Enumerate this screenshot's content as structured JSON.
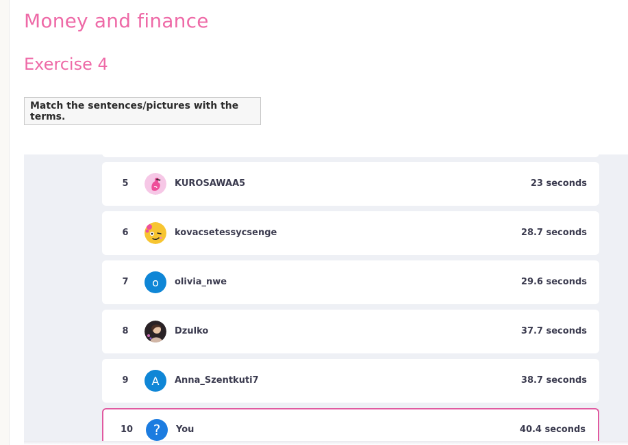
{
  "page": {
    "title": "Money and finance",
    "exercise": "Exercise 4",
    "instruction": "Match the sentences/pictures with the terms."
  },
  "leaderboard": {
    "rows": [
      {
        "rank": "5",
        "name": "KUROSAWAA5",
        "time": "23 seconds",
        "avatar": "flamingo-avatar"
      },
      {
        "rank": "6",
        "name": "kovacsetessycsenge",
        "time": "28.7 seconds",
        "avatar": "emoji-avatar"
      },
      {
        "rank": "7",
        "name": "olivia_nwe",
        "time": "29.6 seconds",
        "avatar": "letter-avatar",
        "letter": "o"
      },
      {
        "rank": "8",
        "name": "Dzulko",
        "time": "37.7 seconds",
        "avatar": "photo-avatar"
      },
      {
        "rank": "9",
        "name": "Anna_Szentkuti7",
        "time": "38.7 seconds",
        "avatar": "letter-avatar",
        "letter": "A"
      },
      {
        "rank": "10",
        "name": "You",
        "time": "40.4 seconds",
        "avatar": "question-avatar",
        "letter": "?"
      }
    ]
  },
  "colors": {
    "accent_pink": "#ee6aa7",
    "you_border": "#e05aa0",
    "avatar_blue": "#0f86d6"
  }
}
